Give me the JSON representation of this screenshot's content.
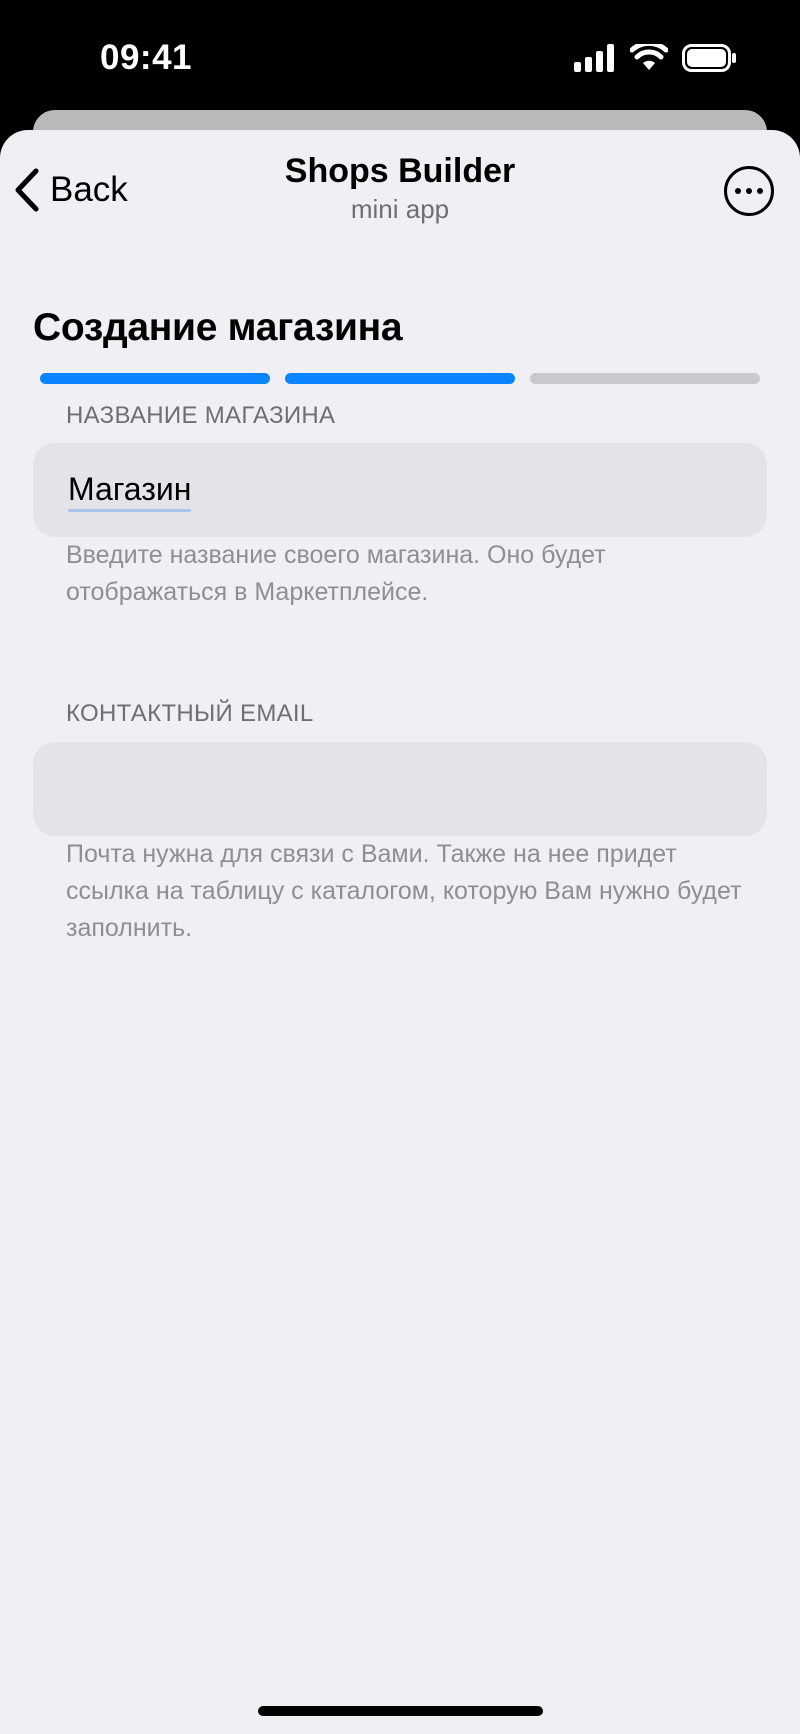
{
  "status_bar": {
    "time": "09:41",
    "icons": [
      "signal-icon",
      "wifi-icon",
      "battery-icon"
    ]
  },
  "nav": {
    "back_label": "Back",
    "title": "Shops Builder",
    "subtitle": "mini app",
    "more_icon": "ellipsis-circle-icon"
  },
  "page": {
    "title": "Создание магазина",
    "progress": {
      "steps_total": 3,
      "steps_completed": 2
    }
  },
  "form": {
    "shop_name": {
      "label": "НАЗВАНИЕ МАГАЗИНА",
      "value": "Магазин",
      "hint": "Введите название своего магазина. Оно будет отображаться в Маркетплейсе."
    },
    "email": {
      "label": "КОНТАКТНЫЙ EMAIL",
      "value": "",
      "hint": "Почта нужна для связи с Вами. Также на нее придет ссылка на таблицу с каталогом, которую Вам нужно будет заполнить."
    }
  },
  "colors": {
    "accent": "#0a84ff",
    "progress_inactive": "#c8c8cd",
    "background": "#efeff4",
    "field_background": "#e3e3e8",
    "hint_text": "#8e8e93"
  }
}
